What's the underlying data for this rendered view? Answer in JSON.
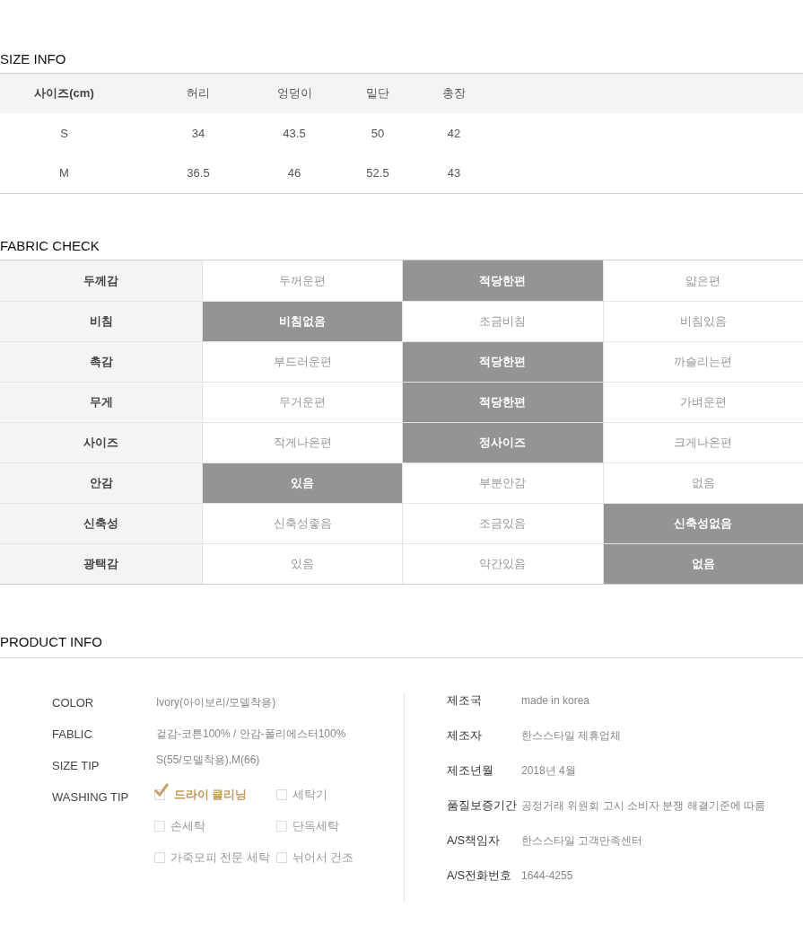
{
  "size_info": {
    "title": "SIZE INFO",
    "columns": [
      "사이즈(cm)",
      "허리",
      "엉덩이",
      "밑단",
      "총장"
    ],
    "rows": [
      [
        "S",
        "34",
        "43.5",
        "50",
        "42"
      ],
      [
        "M",
        "36.5",
        "46",
        "52.5",
        "43"
      ]
    ]
  },
  "fabric_check": {
    "title": "FABRIC CHECK",
    "rows": [
      {
        "label": "두께감",
        "options": [
          {
            "label": "두꺼운편",
            "selected": false
          },
          {
            "label": "적당한편",
            "selected": true
          },
          {
            "label": "얇은편",
            "selected": false
          }
        ]
      },
      {
        "label": "비침",
        "options": [
          {
            "label": "비침없음",
            "selected": true
          },
          {
            "label": "조금비침",
            "selected": false
          },
          {
            "label": "비침있음",
            "selected": false
          }
        ]
      },
      {
        "label": "촉감",
        "options": [
          {
            "label": "부드러운편",
            "selected": false
          },
          {
            "label": "적당한편",
            "selected": true
          },
          {
            "label": "까슬리는편",
            "selected": false
          }
        ]
      },
      {
        "label": "무게",
        "options": [
          {
            "label": "무거운편",
            "selected": false
          },
          {
            "label": "적당한편",
            "selected": true
          },
          {
            "label": "가벼운편",
            "selected": false
          }
        ]
      },
      {
        "label": "사이즈",
        "options": [
          {
            "label": "작게나온편",
            "selected": false
          },
          {
            "label": "정사이즈",
            "selected": true
          },
          {
            "label": "크게나온편",
            "selected": false
          }
        ]
      },
      {
        "label": "안감",
        "options": [
          {
            "label": "있음",
            "selected": true
          },
          {
            "label": "부분안감",
            "selected": false
          },
          {
            "label": "없음",
            "selected": false
          }
        ]
      },
      {
        "label": "신축성",
        "options": [
          {
            "label": "신축성좋음",
            "selected": false
          },
          {
            "label": "조금있음",
            "selected": false
          },
          {
            "label": "신축성없음",
            "selected": true
          }
        ]
      },
      {
        "label": "광택감",
        "options": [
          {
            "label": "있음",
            "selected": false
          },
          {
            "label": "약간있음",
            "selected": false
          },
          {
            "label": "없음",
            "selected": true
          }
        ]
      }
    ]
  },
  "product_info": {
    "title": "PRODUCT INFO",
    "specs": [
      {
        "label": "COLOR",
        "value": "Ivory(아이보리/모델착용)"
      },
      {
        "label": "FABLIC",
        "value": "겉감-코튼100%  /  안감-폴리에스터100%"
      },
      {
        "label": "SIZE TIP",
        "value": "S(55/모델착용),M(66)"
      }
    ],
    "washing": {
      "label": "WASHING TIP",
      "options": [
        {
          "label": "드라이 클리닝",
          "checked": true
        },
        {
          "label": "세탁기",
          "checked": false
        },
        {
          "label": "손세탁",
          "checked": false
        },
        {
          "label": "단독세탁",
          "checked": false
        },
        {
          "label": "가죽모피 전문 세탁",
          "checked": false
        },
        {
          "label": "뉘어서 건조",
          "checked": false
        }
      ]
    },
    "details": [
      {
        "label": "제조국",
        "value": "made in korea"
      },
      {
        "label": "제조자",
        "value": "한스스타일 제휴업체"
      },
      {
        "label": "제조년월",
        "value": "2018년 4월"
      },
      {
        "label": "품질보증기간",
        "value": "공정거래 위원회 고시 소비자 분쟁 해결기준에 따름"
      },
      {
        "label": "A/S책임자",
        "value": "한스스타일 고객만족센터"
      },
      {
        "label": "A/S전화번호",
        "value": "1644-4255"
      }
    ]
  }
}
